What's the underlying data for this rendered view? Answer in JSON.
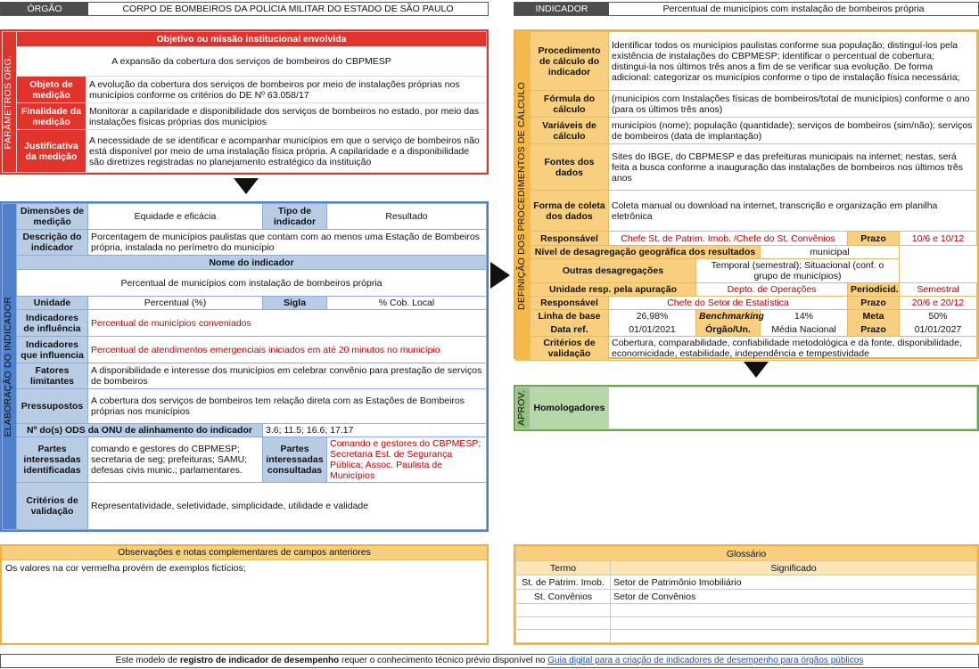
{
  "header_left": {
    "key": "ÓRGÃO",
    "value": "CORPO DE BOMBEIROS DA POLÍCIA MILITAR DO ESTADO DE SÃO PAULO"
  },
  "header_right": {
    "key": "INDICADOR",
    "value": "Percentual de municípios com instalação de bombeiros própria"
  },
  "param": {
    "side": "PARÂMETROS ORG.",
    "objetivo_head": "Objetivo ou missão institucional envolvida",
    "objetivo": "A expansão da cobertura dos serviços de bombeiros do CBPMESP",
    "rows": [
      {
        "label": "Objeto de medição",
        "text": "A evolução da cobertura dos serviços de bombeiros por meio de instalações próprias nos municípios conforme os critérios do DE Nº 63.058/17"
      },
      {
        "label": "Finalidade da medição",
        "text": "Monitorar a capilaridade e disponibilidade dos serviços de bombeiros no estado, por meio das instalações físicas próprias dos municípios"
      },
      {
        "label": "Justificativa da medição",
        "text": "A necessidade de se identificar e acompanhar municípios em que o serviço de bombeiros não está disponível por meio de uma instalação física própria. A capilaridade e a disponibilidade são diretrizes registradas no planejamento estratégico da instituição"
      }
    ]
  },
  "elab": {
    "side": "ELABORAÇÃO DO INDICADOR",
    "dim_label": "Dimensões de medição",
    "dim": "Equidade e eficácia",
    "tipo_label": "Tipo de indicador",
    "tipo": "Resultado",
    "desc_label": "Descrição do indicador",
    "desc": "Porcentagem de municípios paulistas que contam com ao menos uma Estação de Bombeiros própria, instalada no perímetro do município",
    "nome_label": "Nome do indicador",
    "nome": "Percentual de municípios com instalação de bombeiros própria",
    "unidade_label": "Unidade",
    "unidade": "Percentual (%)",
    "sigla_label": "Sigla",
    "sigla": "% Cob. Local",
    "infl_label": "Indicadores de influência",
    "infl": "Percentual de municípios conveniados",
    "infl2_label": "Indicadores que influencia",
    "infl2": "Percentual de atendimentos emergenciais iniciados em até 20 minutos no município",
    "fat_label": "Fatores limitantes",
    "fat": "A disponibilidade e interesse dos municípios em celebrar convênio para prestação de serviços de bombeiros",
    "pres_label": "Pressupostos",
    "pres": "A cobertura dos serviços de bombeiros tem relação direta com as Estações de Bombeiros próprias nos municípios",
    "ods_label": "Nº do(s) ODS da ONU de alinhamento do indicador",
    "ods": "3.6; 11.5; 16.6; 17.17",
    "pi_label": "Partes interessadas identificadas",
    "pi": "comando e gestores do CBPMESP; secretaria de seg; prefeituras; SAMU; defesas civis munic.; parlamentares.",
    "pc_label": "Partes interessadas consultadas",
    "pc": "Comando e gestores do CBPMESP; Secretaria Est. de Segurança Pública; Assoc. Paulista de Municípios",
    "crit_label": "Critérios de validação",
    "crit": "Representatividade, seletividade, simplicidade, utilidade e validade"
  },
  "def": {
    "side": "DEFINIÇÃO DOS PROCEDIMENTOS DE CÁLCULO",
    "proc_label": "Procedimento de cálculo do indicador",
    "proc": "Identificar todos os municípios paulistas conforme sua população; distinguí-los pela existência de instalações do CBPMESP; identificar o percentual de cobertura; distingui-la nos últimos três anos a fim de se verificar sua evolução. De forma adicional: categorizar os municípios conforme o tipo de instalação física necessária;",
    "form_label": "Fórmula do cálculo",
    "form": "(municípios com Instalações físicas de bombeiros/total de municípios) conforme o ano (para os últimos três anos)",
    "var_label": "Variáveis de cálculo",
    "var": "municípios (nome); população (quantidade); serviços de bombeiros (sim/não); serviços de bombeiros (data de implantação)",
    "font_label": "Fontes dos dados",
    "font": "Sites do IBGE, do CBPMESP e das prefeituras municipais na internet; nestas, será feita a busca conforme a inauguração das instalações de bombeiros nos últimos três anos",
    "col_label": "Forma de coleta dos dados",
    "col": "Coleta manual ou download na internet, transcrição e organização em planilha eletrônica",
    "resp_label": "Responsável",
    "resp": "Chefe St. de Patrim. Imob. /Chefe do St. Convênios",
    "prazo_label": "Prazo",
    "prazo": "10/6 e 10/12",
    "niv_label": "Nível de desagregação geográfica dos resultados",
    "niv": "municipal",
    "out_label": "Outras desagregações",
    "out": "Temporal (semestral); Situacional (conf. o grupo de municípios)",
    "uni_label": "Unidade resp. pela apuração",
    "uni": "Depto. de Operações",
    "per_label": "Periodicid.",
    "per": "Semestral",
    "resp2_label": "Responsável",
    "resp2": "Chefe do Setor de Estatística",
    "prazo2_label": "Prazo",
    "prazo2": "20/6 e 20/12",
    "lb_label": "Linha de base",
    "lb": "26,98%",
    "bench_label": "Benchmarking",
    "bench": "14%",
    "meta_label": "Meta",
    "meta": "50%",
    "dref_label": "Data ref.",
    "dref": "01/01/2021",
    "org_label": "Órgão/Un.",
    "org": "Média Nacional",
    "prazo3_label": "Prazo",
    "prazo3": "01/01/2027",
    "crit_label": "Critérios de validação",
    "crit": "Cobertura, comparabilidade, confiabilidade metodológica e da fonte, disponibilidade, economicidade, estabilidade, independência e tempestividade"
  },
  "aprov": {
    "side": "APROV.",
    "label": "Homologadores",
    "value": ""
  },
  "obs": {
    "head": "Observações e notas complementares de campos anteriores",
    "text": "Os valores na cor vermelha provém de exemplos fictícios;"
  },
  "glos": {
    "head": "Glossário",
    "col1": "Termo",
    "col2": "Significado",
    "rows": [
      {
        "t": "St. de Patrim. Imob.",
        "s": "Setor de Patrimônio Imobiliário"
      },
      {
        "t": "St. Convênios",
        "s": "Setor de Convênios"
      }
    ]
  },
  "footer": {
    "pre": "Este modelo de ",
    "bold": "registro de indicador de desempenho",
    "mid": " requer o conhecimento técnico prévio disponível no  ",
    "link": "Guia digital para a criação de indicadores de desempenho para órgãos públicos"
  }
}
